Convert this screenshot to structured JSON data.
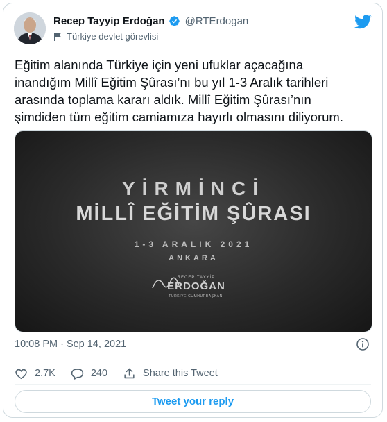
{
  "author": {
    "display_name": "Recep Tayyip Erdoğan",
    "handle": "@RTErdogan",
    "label": "Türkiye devlet görevlisi",
    "verified": true
  },
  "tweet": {
    "text": "Eğitim alanında Türkiye için yeni ufuklar açacağına\ninandığım Millî Eğitim Şûrası’nı bu yıl 1-3 Aralık tarihleri\narasında toplama kararı aldık. Millî Eğitim Şûrası’nın\nşimdiden tüm eğitim camiamıza hayırlı olmasını diliyorum.",
    "timestamp": "10:08 PM · Sep 14, 2021"
  },
  "media": {
    "line1": "YİRMİNCİ",
    "line2": "MİLLÎ EĞİTİM ŞÛRASI",
    "dates": "1-3 ARALIK 2021",
    "city": "ANKARA",
    "sig_top": "RECEP TAYYİP",
    "sig_name": "ERDOĞAN",
    "sig_title": "TÜRKİYE CUMHURBAŞKANI"
  },
  "actions": {
    "likes": "2.7K",
    "replies": "240",
    "share_label": "Share this Tweet"
  },
  "reply_button": "Tweet your reply",
  "colors": {
    "brand_blue": "#1d9bf0",
    "secondary_text": "#536471",
    "border": "#cfd9de"
  },
  "icons": {
    "logo": "twitter-bird-icon",
    "verified": "verified-badge-icon",
    "label": "flag-icon",
    "info": "info-icon",
    "like": "heart-icon",
    "reply": "reply-bubble-icon",
    "share": "share-icon"
  }
}
